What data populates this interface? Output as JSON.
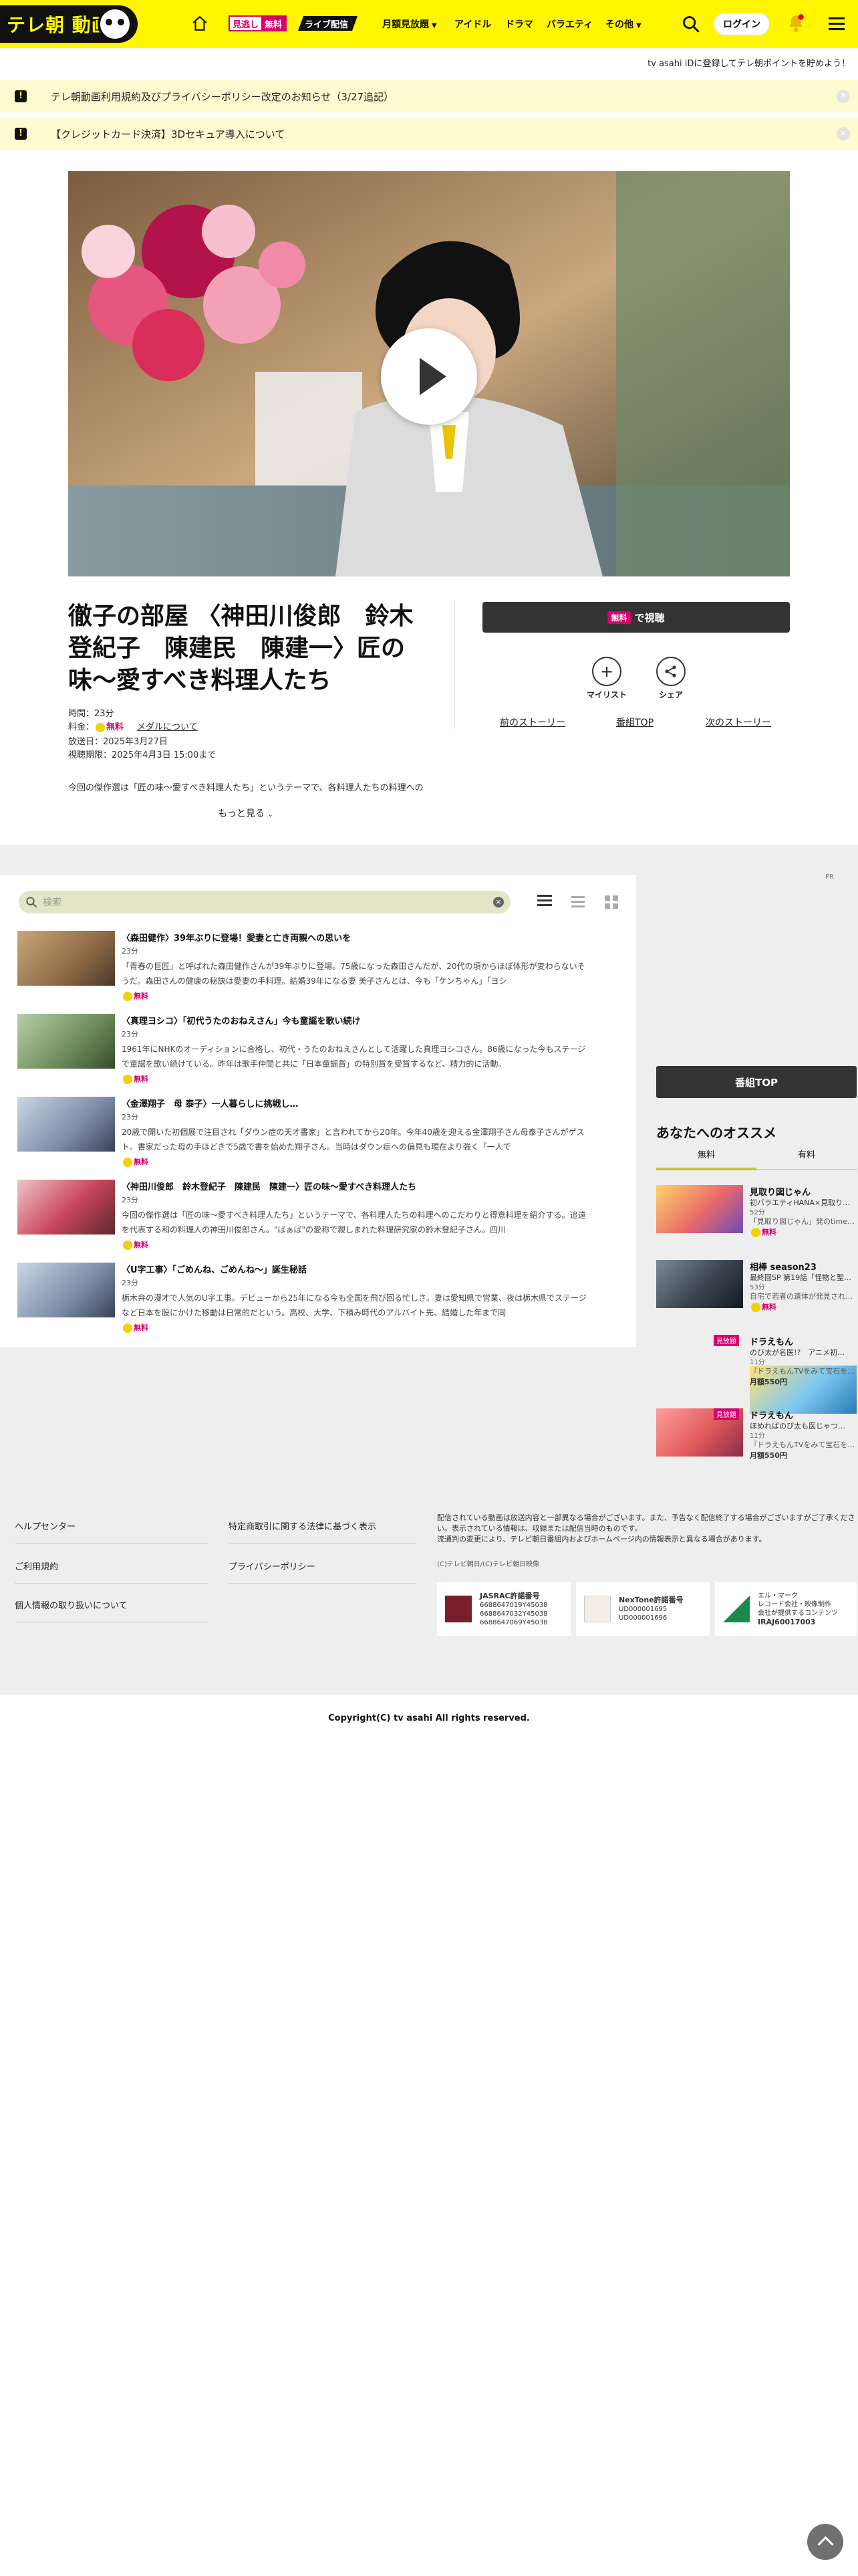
{
  "header": {
    "logo_text": "テレ朝 動画",
    "badge_prefix": "見逃し",
    "badge_free": "無料",
    "live_label": "ライブ配信",
    "menu": [
      "月額見放題",
      "アイドル",
      "ドラマ",
      "バラエティ",
      "その他"
    ],
    "login_label": "ログイン"
  },
  "promo_text": "tv asahi iDに登録してテレ朝ポイントを貯めよう！",
  "notices": [
    "テレ朝動画利用規約及びプライバシーポリシー改定のお知らせ（3/27追記）",
    "【クレジットカード決済】3Dセキュア導入について"
  ],
  "program": {
    "title": "徹子の部屋 〈神田川俊郎　鈴木登紀子　陳建民　陳建一〉匠の味〜愛すべき料理人たち",
    "duration": "時間：23分",
    "price_label": "料金：",
    "price_free": "無料",
    "medal_link": "メダルについて",
    "aired": "放送日：2025年3月27日",
    "period": "視聴期限：2025年4月3日 15:00まで",
    "description": "今回の傑作選は「匠の味〜愛すべき料理人たち」というテーマで、各料理人たちの料理への",
    "more_label": "もっと見る",
    "watch_badge": "無料",
    "watch_label": "で視聴",
    "mylist_label": "マイリスト",
    "share_label": "シェア",
    "prev_label": "前のストーリー",
    "top_label": "番組TOP",
    "next_label": "次のストーリー"
  },
  "ad_label": "PR",
  "search": {
    "placeholder": "検索"
  },
  "episodes": [
    {
      "title": "〈森田健作〉39年ぶりに登場！愛妻と亡き両親への思いを",
      "duration": "23分",
      "text": "「青春の巨匠」と呼ばれた森田健作さんが39年ぶりに登場。75歳になった森田さんだが、20代の頃からほぼ体形が変わらないそうだ。森田さんの健康の秘訣は愛妻の手料理。結婚39年になる妻 美子さんとは、今も「ケンちゃん」「ヨシ",
      "free": "無料"
    },
    {
      "title": "〈真理ヨシコ〉「初代うたのおねえさん」今も童謡を歌い続け",
      "duration": "23分",
      "text": "1961年にNHKのオーディションに合格し、初代・うたのおねえさんとして活躍した真理ヨシコさん。86歳になった今もステージで童謡を歌い続けている。昨年は歌手仲間と共に「日本童謡賞」の特別賞を受賞するなど、精力的に活動。",
      "free": "無料"
    },
    {
      "title": "〈金澤翔子　母 泰子〉一人暮らしに挑戦し…",
      "duration": "23分",
      "text": "20歳で開いた初個展で注目され「ダウン症の天才書家」と言われてから20年。今年40歳を迎える金澤翔子さん母泰子さんがゲスト。書家だった母の手ほどきで5歳で書を始めた翔子さん。当時はダウン症への偏見も現在より強く「一人で",
      "free": "無料"
    },
    {
      "title": "〈神田川俊郎　鈴木登紀子　陳建民　陳建一〉匠の味〜愛すべき料理人たち",
      "duration": "23分",
      "text": "今回の傑作選は「匠の味〜愛すべき料理人たち」というテーマで、各料理人たちの料理へのこだわりと得意料理を紹介する。追遠を代表する和の料理人の神田川俊郎さん。\"ばぁば\"の愛称で親しまれた料理研究家の鈴木登紀子さん。四川",
      "free": "無料"
    },
    {
      "title": "〈U字工事〉「ごめんね、ごめんね〜」誕生秘話",
      "duration": "23分",
      "text": "栃木弁の漫才で人気のU字工事。デビューから25年になる今も全国を飛び回る忙しさ。妻は愛知県で営業、夜は栃木県でステージなど日本を股にかけた移動は日常的だという。高校、大学、下積み時代のアルバイト先、結婚した年まで同",
      "free": "無料"
    }
  ],
  "sidebar": {
    "top_label": "番組TOP",
    "heading": "あなたへのオススメ",
    "tabs": [
      "無料",
      "有料"
    ],
    "items": [
      {
        "title": "見取り図じゃん",
        "sub": "初バラエティHANA×見取り…",
        "dur": "52分",
        "desc": "「見取り図じゃん」発のtime…",
        "price": "無料",
        "tag": ""
      },
      {
        "title": "相棒 season23",
        "sub": "最終回SP 第19話「怪物と聖…",
        "dur": "53分",
        "desc": "自宅で若者の遺体が発見され…",
        "price": "無料",
        "tag": ""
      },
      {
        "title": "ドラえもん",
        "sub": "のび太が名医!?　アニメ初…",
        "dur": "11分",
        "desc": "『ドラえもんTVをみて宝石を…",
        "price": "月額550円",
        "tag": "見放題"
      },
      {
        "title": "ドラえもん",
        "sub": "ほめればのび太も医じゃつ…",
        "dur": "11分",
        "desc": "『ドラえもんTVをみて宝石を…",
        "price": "月額550円",
        "tag": "見放題"
      }
    ]
  },
  "footer": {
    "left": [
      "ヘルプセンター",
      "ご利用規約",
      "個人情報の取り扱いについて"
    ],
    "middle": [
      "特定商取引に関する法律に基づく表示",
      "プライバシーポリシー"
    ],
    "note": "配信されている動画は放送内容と一部異なる場合がございます。また、予告なく配信終了する場合がございますがご了承ください。表示されている情報は、収録または配信当時のものです。\n流通判の変更により、テレビ朝日番組内およびホームページ内の情報表示と異なる場合があります。",
    "note2": "(C)テレビ朝日/(C)テレビ朝日映像",
    "licenses": [
      {
        "name": "JASRAC許諾番号",
        "nums": [
          "6688647019Y45038",
          "6688647032Y45038",
          "6688647069Y45038"
        ]
      },
      {
        "name": "NexTone許諾番号",
        "nums": [
          "UD000001695",
          "UD000001696"
        ]
      },
      {
        "name": "エル・マーク",
        "nums": [
          "レコード会社・映像制作",
          "会社が提供するコンテンツ",
          "IRAJ60017003"
        ]
      }
    ],
    "copyright": "Copyright(C) tv asahi All rights reserved."
  },
  "colors": {
    "brand_yellow": "#fff600",
    "accent_pink": "#d6006f"
  }
}
